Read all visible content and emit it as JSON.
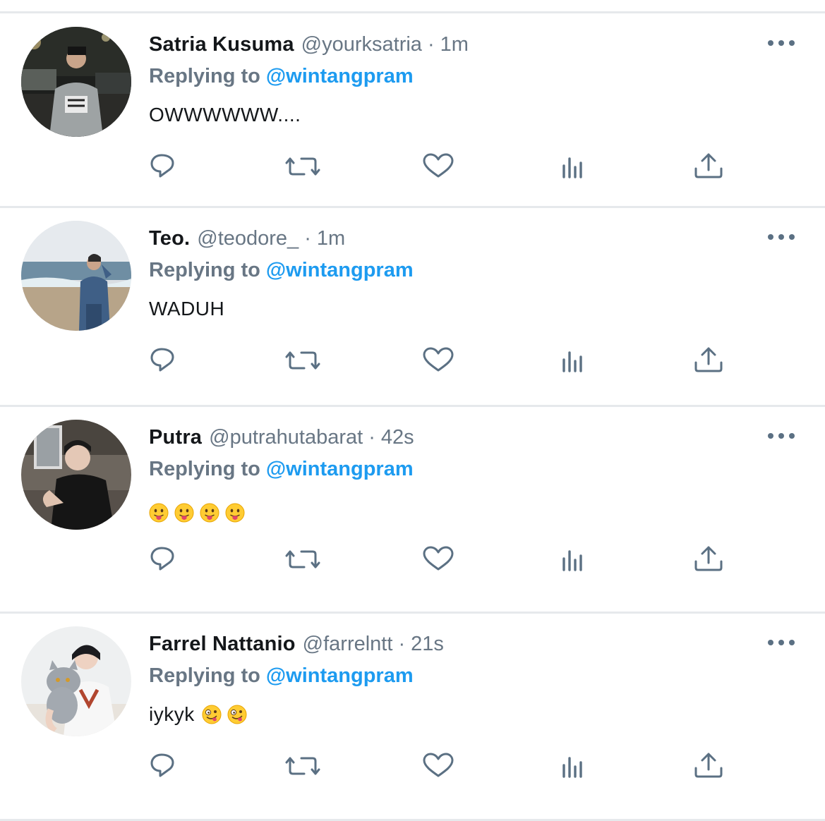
{
  "colors": {
    "name": "#14171a",
    "meta": "#687684",
    "mention": "#1d9bf0",
    "icon": "#5b7083",
    "divider": "#e6e9ec"
  },
  "tweets": [
    {
      "name": "Satria Kusuma",
      "handle": "@yourksatria",
      "separator": "·",
      "time": "1m",
      "replying_label": "Replying to",
      "replying_to": "@wintangpram",
      "text": "OWWWWWW....",
      "emojis": [],
      "avatar": "avatar-night-street-photo"
    },
    {
      "name": "Teo.",
      "handle": "@teodore_",
      "separator": "·",
      "time": "1m",
      "replying_label": "Replying to",
      "replying_to": "@wintangpram",
      "text": "WADUH",
      "emojis": [],
      "avatar": "avatar-beach-photo"
    },
    {
      "name": "Putra",
      "handle": "@putrahutabarat",
      "separator": "·",
      "time": "42s",
      "replying_label": "Replying to",
      "replying_to": "@wintangpram",
      "text": "",
      "emojis": [
        "face-with-tongue",
        "face-with-tongue",
        "face-with-tongue",
        "face-with-tongue"
      ],
      "avatar": "avatar-black-shirt-photo"
    },
    {
      "name": "Farrel Nattanio",
      "handle": "@farrelntt",
      "separator": "·",
      "time": "21s",
      "replying_label": "Replying to",
      "replying_to": "@wintangpram",
      "text": "iykyk",
      "emojis": [
        "zany-face",
        "zany-face"
      ],
      "avatar": "avatar-cat-photo"
    }
  ],
  "action_icons": [
    "reply-icon",
    "retweet-icon",
    "like-icon",
    "analytics-icon",
    "share-icon"
  ]
}
